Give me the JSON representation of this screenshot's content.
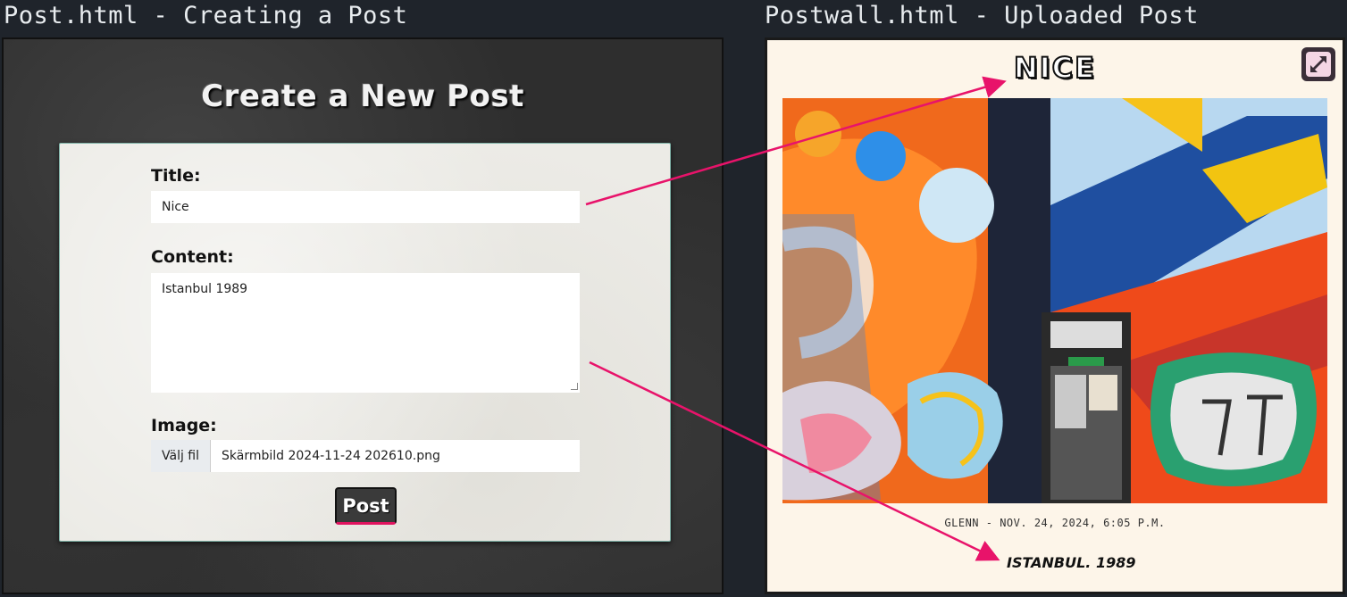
{
  "captions": {
    "left": "Post.html - Creating a Post",
    "right": "Postwall.html - Uploaded Post"
  },
  "create_form": {
    "heading": "Create a New Post",
    "title_label": "Title:",
    "title_value": "Nice",
    "content_label": "Content:",
    "content_value": "Istanbul 1989",
    "image_label": "Image:",
    "file_button_label": "Välj fil",
    "file_name": "Skärmbild 2024-11-24 202610.png",
    "submit_label": "Post"
  },
  "uploaded_post": {
    "title": "NICE",
    "meta": "GLENN - NOV. 24, 2024, 6:05 P.M.",
    "content": "ISTANBUL. 1989",
    "expand_icon": "expand-arrows-icon"
  },
  "colors": {
    "arrow": "#e8136a",
    "page_bg": "#1f242b",
    "post_bg": "#fdf5e9",
    "card_bg": "#ecebe6"
  }
}
